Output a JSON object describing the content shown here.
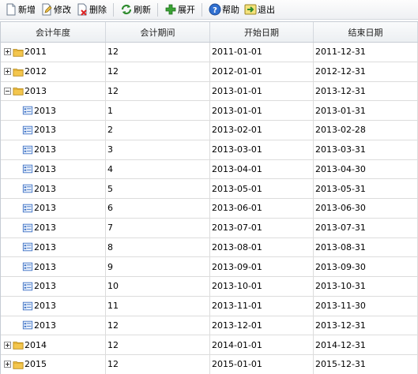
{
  "toolbar": {
    "buttons": [
      {
        "label": "新增",
        "icon": "new-document-icon"
      },
      {
        "label": "修改",
        "icon": "edit-icon"
      },
      {
        "label": "删除",
        "icon": "delete-icon"
      },
      {
        "label": "刷新",
        "icon": "refresh-icon"
      },
      {
        "label": "展开",
        "icon": "expand-icon"
      },
      {
        "label": "帮助",
        "icon": "help-icon"
      },
      {
        "label": "退出",
        "icon": "exit-icon"
      }
    ]
  },
  "grid": {
    "columns": [
      "会计年度",
      "会计期间",
      "开始日期",
      "结束日期"
    ],
    "rows": [
      {
        "type": "year",
        "expanded": false,
        "year": "2011",
        "period": "12",
        "start": "2011-01-01",
        "end": "2011-12-31"
      },
      {
        "type": "year",
        "expanded": false,
        "year": "2012",
        "period": "12",
        "start": "2012-01-01",
        "end": "2012-12-31"
      },
      {
        "type": "year",
        "expanded": true,
        "year": "2013",
        "period": "12",
        "start": "2013-01-01",
        "end": "2013-12-31"
      },
      {
        "type": "period",
        "year": "2013",
        "period": "1",
        "start": "2013-01-01",
        "end": "2013-01-31"
      },
      {
        "type": "period",
        "year": "2013",
        "period": "2",
        "start": "2013-02-01",
        "end": "2013-02-28"
      },
      {
        "type": "period",
        "year": "2013",
        "period": "3",
        "start": "2013-03-01",
        "end": "2013-03-31"
      },
      {
        "type": "period",
        "year": "2013",
        "period": "4",
        "start": "2013-04-01",
        "end": "2013-04-30"
      },
      {
        "type": "period",
        "year": "2013",
        "period": "5",
        "start": "2013-05-01",
        "end": "2013-05-31"
      },
      {
        "type": "period",
        "year": "2013",
        "period": "6",
        "start": "2013-06-01",
        "end": "2013-06-30"
      },
      {
        "type": "period",
        "year": "2013",
        "period": "7",
        "start": "2013-07-01",
        "end": "2013-07-31"
      },
      {
        "type": "period",
        "year": "2013",
        "period": "8",
        "start": "2013-08-01",
        "end": "2013-08-31"
      },
      {
        "type": "period",
        "year": "2013",
        "period": "9",
        "start": "2013-09-01",
        "end": "2013-09-30"
      },
      {
        "type": "period",
        "year": "2013",
        "period": "10",
        "start": "2013-10-01",
        "end": "2013-10-31"
      },
      {
        "type": "period",
        "year": "2013",
        "period": "11",
        "start": "2013-11-01",
        "end": "2013-11-30"
      },
      {
        "type": "period",
        "year": "2013",
        "period": "12",
        "start": "2013-12-01",
        "end": "2013-12-31"
      },
      {
        "type": "year",
        "expanded": false,
        "year": "2014",
        "period": "12",
        "start": "2014-01-01",
        "end": "2014-12-31"
      },
      {
        "type": "year",
        "expanded": false,
        "year": "2015",
        "period": "12",
        "start": "2015-01-01",
        "end": "2015-12-31"
      }
    ]
  }
}
